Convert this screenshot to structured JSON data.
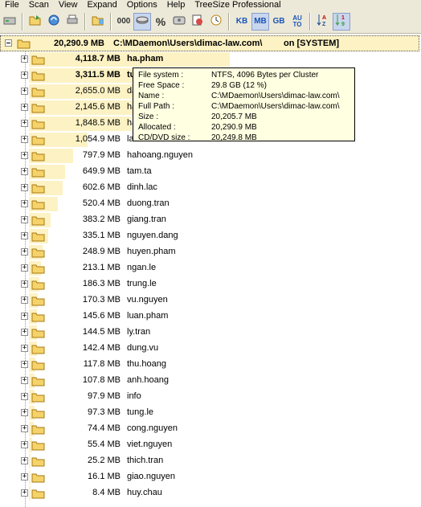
{
  "menu": [
    "File",
    "Scan",
    "View",
    "Expand",
    "Options",
    "Help",
    "TreeSize Professional"
  ],
  "toolbar": {
    "unit_buttons": [
      "KB",
      "MB",
      "GB"
    ],
    "auto_label": "AU TO",
    "count_label": "000",
    "percent_label": "%"
  },
  "root": {
    "size": "20,290.9 MB",
    "path": "C:\\MDaemon\\Users\\dimac-law.com\\",
    "suffix": "on [SYSTEM]"
  },
  "tooltip": {
    "rows": [
      {
        "label": "File system :",
        "value": "NTFS, 4096 Bytes per Cluster"
      },
      {
        "label": "Free Space :",
        "value": "29.8 GB  (12 %)"
      },
      {
        "label": "Name :",
        "value": "C:\\MDaemon\\Users\\dimac-law.com\\"
      },
      {
        "label": "Full Path :",
        "value": "C:\\MDaemon\\Users\\dimac-law.com\\"
      },
      {
        "label": "Size :",
        "value": "20,205.7 MB"
      },
      {
        "label": "Allocated :",
        "value": "20,290.9 MB"
      },
      {
        "label": "CD/DVD size :",
        "value": "20,249.8 MB"
      }
    ]
  },
  "folders": [
    {
      "size": "4,118.7 MB",
      "name": "ha.pham",
      "bold": true,
      "fraction": 0.203
    },
    {
      "size": "3,311.5 MB",
      "name": "tu",
      "bold": true,
      "fraction": 0.163
    },
    {
      "size": "2,655.0 MB",
      "name": "dao",
      "bold": false,
      "fraction": 0.131
    },
    {
      "size": "2,145.6 MB",
      "name": "ha",
      "bold": false,
      "fraction": 0.106
    },
    {
      "size": "1,848.5 MB",
      "name": "ha",
      "bold": false,
      "fraction": 0.091
    },
    {
      "size": "1,054.9 MB",
      "name": "lam",
      "bold": false,
      "fraction": 0.052
    },
    {
      "size": "797.9 MB",
      "name": "hahoang.nguyen",
      "bold": false,
      "fraction": 0.039
    },
    {
      "size": "649.9 MB",
      "name": "tam.ta",
      "bold": false,
      "fraction": 0.032
    },
    {
      "size": "602.6 MB",
      "name": "dinh.lac",
      "bold": false,
      "fraction": 0.03
    },
    {
      "size": "520.4 MB",
      "name": "duong.tran",
      "bold": false,
      "fraction": 0.026
    },
    {
      "size": "383.2 MB",
      "name": "giang.tran",
      "bold": false,
      "fraction": 0.019
    },
    {
      "size": "335.1 MB",
      "name": "nguyen.dang",
      "bold": false,
      "fraction": 0.017
    },
    {
      "size": "248.9 MB",
      "name": "huyen.pham",
      "bold": false,
      "fraction": 0.012
    },
    {
      "size": "213.1 MB",
      "name": "ngan.le",
      "bold": false,
      "fraction": 0.011
    },
    {
      "size": "186.3 MB",
      "name": "trung.le",
      "bold": false,
      "fraction": 0.009
    },
    {
      "size": "170.3 MB",
      "name": "vu.nguyen",
      "bold": false,
      "fraction": 0.008
    },
    {
      "size": "145.6 MB",
      "name": "luan.pham",
      "bold": false,
      "fraction": 0.007
    },
    {
      "size": "144.5 MB",
      "name": "ly.tran",
      "bold": false,
      "fraction": 0.007
    },
    {
      "size": "142.4 MB",
      "name": "dung.vu",
      "bold": false,
      "fraction": 0.007
    },
    {
      "size": "117.8 MB",
      "name": "thu.hoang",
      "bold": false,
      "fraction": 0.006
    },
    {
      "size": "107.8 MB",
      "name": "anh.hoang",
      "bold": false,
      "fraction": 0.005
    },
    {
      "size": "97.9 MB",
      "name": "info",
      "bold": false,
      "fraction": 0.005
    },
    {
      "size": "97.3 MB",
      "name": "tung.le",
      "bold": false,
      "fraction": 0.005
    },
    {
      "size": "74.4 MB",
      "name": "cong.nguyen",
      "bold": false,
      "fraction": 0.004
    },
    {
      "size": "55.4 MB",
      "name": "viet.nguyen",
      "bold": false,
      "fraction": 0.003
    },
    {
      "size": "25.2 MB",
      "name": "thich.tran",
      "bold": false,
      "fraction": 0.001
    },
    {
      "size": "16.1 MB",
      "name": "giao.nguyen",
      "bold": false,
      "fraction": 0.001
    },
    {
      "size": "8.4 MB",
      "name": "huy.chau",
      "bold": false,
      "fraction": 0.0004
    }
  ],
  "icons": {
    "folder_color": "#f5d36a",
    "bar_color": "#fdf2c4",
    "accent": "#1b54b8"
  }
}
